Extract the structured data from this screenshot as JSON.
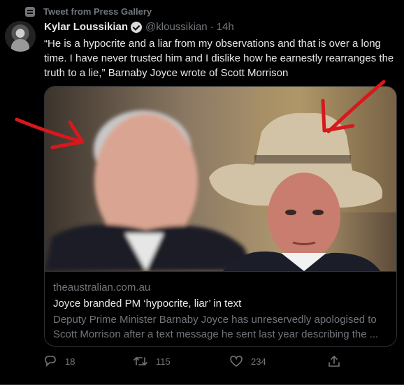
{
  "context": {
    "label": "Tweet from Press Gallery",
    "icon": "list-icon"
  },
  "author": {
    "name": "Kylar Loussikian",
    "handle": "@kloussikian",
    "separator": "·",
    "time": "14h",
    "verified": true
  },
  "tweet_text": "“He is a hypocrite and a liar from my observations and that is over a long time. I have never trusted him and I dislike how he earnestly rearranges the truth to a lie,” Barnaby Joyce wrote of Scott Morrison",
  "card": {
    "domain": "theaustralian.com.au",
    "headline": "Joyce branded PM ‘hypocrite, liar’ in text",
    "description": "Deputy Prime Minister Barnaby Joyce has unreservedly apologised to Scott Morrison after a text message he sent last year describing the ..."
  },
  "actions": {
    "replies": "18",
    "retweets": "115",
    "likes": "234"
  },
  "colors": {
    "background": "#000000",
    "text": "#e7e9ea",
    "muted": "#71767b",
    "border": "#2f3336",
    "annotation_arrows": "#d8181c"
  }
}
